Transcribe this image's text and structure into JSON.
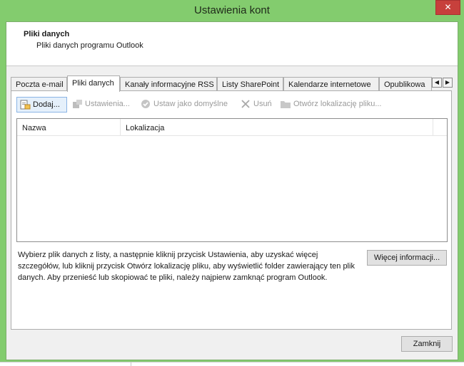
{
  "window": {
    "title": "Ustawienia kont",
    "close_glyph": "✕"
  },
  "header": {
    "title": "Pliki danych",
    "subtitle": "Pliki danych programu Outlook"
  },
  "tabs": [
    {
      "label": "Poczta e-mail",
      "active": false
    },
    {
      "label": "Pliki danych",
      "active": true
    },
    {
      "label": "Kanały informacyjne RSS",
      "active": false
    },
    {
      "label": "Listy SharePoint",
      "active": false
    },
    {
      "label": "Kalendarze internetowe",
      "active": false
    },
    {
      "label": "Opublikowa",
      "active": false
    }
  ],
  "tab_scroll": {
    "left": "◀",
    "right": "▶"
  },
  "toolbar": {
    "add": {
      "label": "Dodaj...",
      "icon": "add-data-file-icon",
      "enabled": true
    },
    "settings": {
      "label": "Ustawienia...",
      "icon": "settings-icon",
      "enabled": false
    },
    "set_default": {
      "label": "Ustaw jako domyślne",
      "icon": "checkmark-circle-icon",
      "enabled": false
    },
    "remove": {
      "label": "Usuń",
      "icon": "x-icon",
      "enabled": false
    },
    "open_location": {
      "label": "Otwórz lokalizację pliku...",
      "icon": "folder-icon",
      "enabled": false
    }
  },
  "list": {
    "columns": [
      "Nazwa",
      "Lokalizacja"
    ],
    "rows": []
  },
  "description": "Wybierz plik danych z listy, a następnie kliknij przycisk Ustawienia, aby uzyskać więcej szczegółów, lub kliknij przycisk Otwórz lokalizację pliku, aby wyświetlić folder zawierający ten plik danych. Aby przenieść lub skopiować te pliki, należy najpierw zamknąć program Outlook.",
  "buttons": {
    "more_info": "Więcej informacji...",
    "close": "Zamknij"
  },
  "colors": {
    "titlebar": "#83cc6e",
    "close_button": "#c7403c",
    "dialog_background": "#f0f0f0",
    "selected_button_border": "#8ab4e4"
  }
}
